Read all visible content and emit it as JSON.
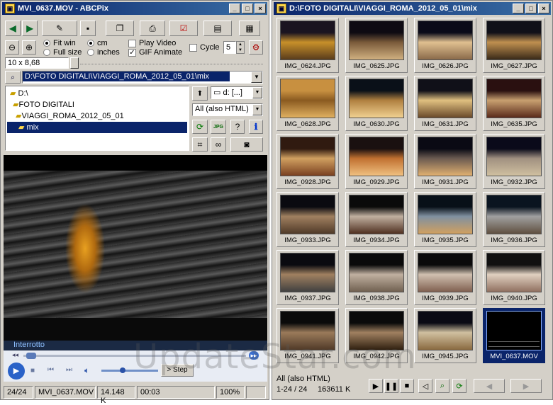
{
  "left_window": {
    "title": "MVI_0637.MOV - ABCPix",
    "controls": {
      "minimize": "_",
      "maximize": "□",
      "close": "×"
    }
  },
  "toolbar": {
    "back_icon": "arrow-left-icon",
    "forward_icon": "arrow-right-icon"
  },
  "options": {
    "fit_win": "Fit win",
    "full_size": "Full size",
    "cm": "cm",
    "inches": "inches",
    "play_video": "Play Video",
    "gif_animate": "GIF Animate",
    "cycle": "Cycle",
    "cycle_value": "5",
    "size_value": "10 x 8,68"
  },
  "path": {
    "current": "D:\\FOTO DIGITALI\\VIAGGI_ROMA_2012_05_01\\mix"
  },
  "tree": {
    "items": [
      {
        "label": "D:\\"
      },
      {
        "label": "FOTO DIGITALI"
      },
      {
        "label": "VIAGGI_ROMA_2012_05_01"
      },
      {
        "label": "mix"
      }
    ]
  },
  "drive": {
    "selected": "d: [...]"
  },
  "filter": {
    "selected": "All (also HTML)"
  },
  "player": {
    "status": "Interrotto",
    "step_label": "> Step"
  },
  "statusbar": {
    "count": "24/24",
    "filename": "MVI_0637.MOV",
    "size": "14.148 K",
    "time": "00:03",
    "zoom": "100%"
  },
  "right_window": {
    "title": "D:\\FOTO DIGITALI\\VIAGGI_ROMA_2012_05_01\\mix",
    "controls": {
      "minimize": "_",
      "maximize": "□",
      "close": "×"
    }
  },
  "thumbnails": [
    {
      "name": "IMG_0624.JPG"
    },
    {
      "name": "IMG_0625.JPG"
    },
    {
      "name": "IMG_0626.JPG"
    },
    {
      "name": "IMG_0627.JPG"
    },
    {
      "name": "IMG_0628.JPG"
    },
    {
      "name": "IMG_0630.JPG"
    },
    {
      "name": "IMG_0631.JPG"
    },
    {
      "name": "IMG_0635.JPG"
    },
    {
      "name": "IMG_0928.JPG"
    },
    {
      "name": "IMG_0929.JPG"
    },
    {
      "name": "IMG_0931.JPG"
    },
    {
      "name": "IMG_0932.JPG"
    },
    {
      "name": "IMG_0933.JPG"
    },
    {
      "name": "IMG_0934.JPG"
    },
    {
      "name": "IMG_0935.JPG"
    },
    {
      "name": "IMG_0936.JPG"
    },
    {
      "name": "IMG_0937.JPG"
    },
    {
      "name": "IMG_0938.JPG"
    },
    {
      "name": "IMG_0939.JPG"
    },
    {
      "name": "IMG_0940.JPG"
    },
    {
      "name": "IMG_0941.JPG"
    },
    {
      "name": "IMG_0942.JPG"
    },
    {
      "name": "IMG_0945.JPG"
    },
    {
      "name": "MVI_0637.MOV"
    }
  ],
  "footer": {
    "filter": "All (also HTML)",
    "range": "1-24 / 24",
    "total": "163611 K"
  },
  "watermark": "UpdateStar.com"
}
